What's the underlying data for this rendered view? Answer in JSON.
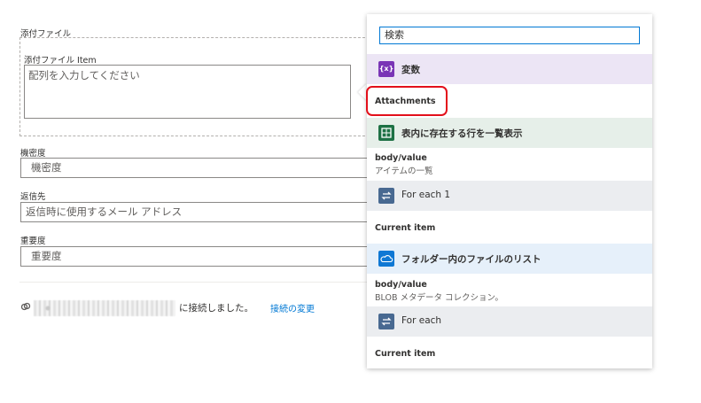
{
  "form": {
    "attachments_label": "添付ファイル",
    "attachment_item_label": "添付ファイル Item",
    "attachment_item_placeholder": "配列を入力してください",
    "sensitivity_label": "機密度",
    "sensitivity_value": "機密度",
    "reply_to_label": "返信先",
    "reply_to_placeholder": "返信時に使用するメール アドレス",
    "importance_label": "重要度",
    "importance_value": "重要度"
  },
  "connection": {
    "connected_text": "に接続しました。",
    "change_link": "接続の変更"
  },
  "panel": {
    "search_placeholder": "検索",
    "sections": [
      {
        "icon": "variable-icon",
        "title": "変数",
        "color": "#7a35b6",
        "bg": "#ece5f5",
        "items": [
          {
            "title": "Attachments",
            "sub": ""
          }
        ]
      },
      {
        "icon": "excel-icon",
        "title": "表内に存在する行を一覧表示",
        "color": "#1e7145",
        "bg": "#e6efe9",
        "items": [
          {
            "title": "body/value",
            "sub": "アイテムの一覧"
          }
        ]
      },
      {
        "icon": "loop-icon",
        "title": "For each 1",
        "color": "#486991",
        "bg": "#ebedf0",
        "items": [
          {
            "title": "Current item",
            "sub": ""
          }
        ]
      },
      {
        "icon": "onedrive-icon",
        "title": "フォルダー内のファイルのリスト",
        "color": "#0f78d4",
        "bg": "#e6f0fa",
        "items": [
          {
            "title": "body/value",
            "sub": "BLOB メタデータ コレクション。"
          }
        ]
      },
      {
        "icon": "loop-icon",
        "title": "For each",
        "color": "#486991",
        "bg": "#ebedf0",
        "items": [
          {
            "title": "Current item",
            "sub": ""
          }
        ]
      }
    ]
  }
}
